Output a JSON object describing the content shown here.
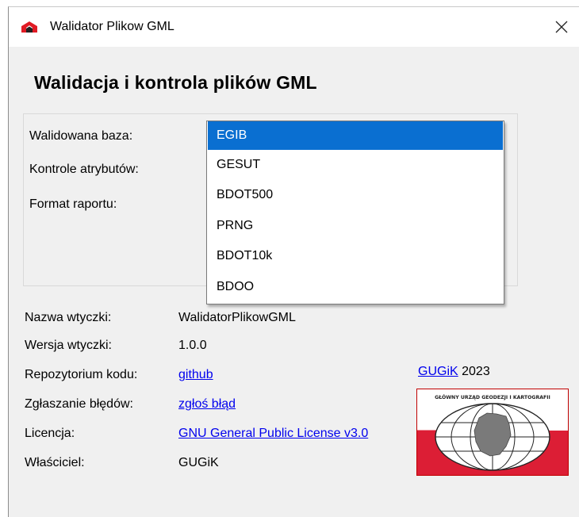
{
  "window": {
    "title": "Walidator Plikow GML",
    "close_glyph": "✕"
  },
  "heading": "Walidacja i kontrola plików GML",
  "form": {
    "labels": [
      "Walidowana baza:",
      "Kontrole atrybutów:",
      "Format raportu:"
    ]
  },
  "dropdown": {
    "selected_index": 0,
    "options": [
      "EGIB",
      "GESUT",
      "BDOT500",
      "PRNG",
      "BDOT10k",
      "BDOO"
    ],
    "highlight_color": "#0a6fd1"
  },
  "info": {
    "rows": [
      {
        "label": "Nazwa wtyczki:",
        "value": "WalidatorPlikowGML",
        "is_link": false
      },
      {
        "label": "Wersja wtyczki:",
        "value": "1.0.0",
        "is_link": false
      },
      {
        "label": "Repozytorium kodu:",
        "value": "github",
        "is_link": true
      },
      {
        "label": "Zgłaszanie błędów:",
        "value": "zgłoś błąd",
        "is_link": true
      },
      {
        "label": "Licencja:",
        "value": "GNU General Public License v3.0",
        "is_link": true
      },
      {
        "label": "Właściciel:",
        "value": "GUGiK",
        "is_link": false
      }
    ]
  },
  "brand": {
    "link": "GUGiK",
    "year": "2023",
    "logo_text": "GŁÓWNY URZĄD GEODEZJI I KARTOGRAFII",
    "logo_red": "#dc1e35",
    "link_color": "#0000ee"
  }
}
